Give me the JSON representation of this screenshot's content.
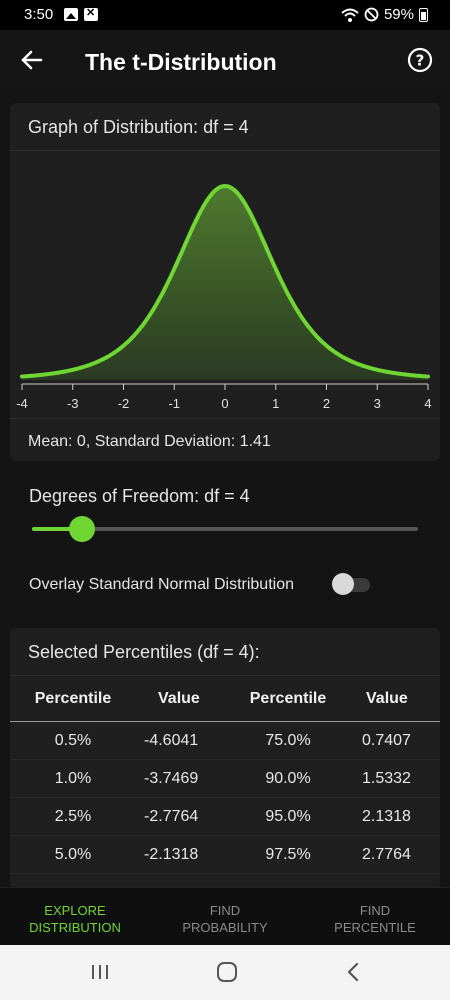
{
  "status_bar": {
    "time": "3:50",
    "battery": "59%",
    "icons": [
      "image-icon",
      "close-box-icon",
      "wifi-icon",
      "do-not-disturb-icon",
      "battery-icon"
    ]
  },
  "app_bar": {
    "title": "The t-Distribution",
    "back_icon": "arrow-left-icon",
    "help_icon": "help-circle-icon"
  },
  "graph_card": {
    "title": "Graph of Distribution: df = 4",
    "stats": "Mean: 0, Standard Deviation: 1.41"
  },
  "chart_data": {
    "type": "area",
    "distribution": "t",
    "df": 4,
    "xlim": [
      -4,
      4
    ],
    "x_ticks": [
      "-4",
      "-3",
      "-2",
      "-1",
      "0",
      "1",
      "2",
      "3",
      "4"
    ],
    "line_color": "#6fd634",
    "fill_color": "#4e7a2e"
  },
  "controls": {
    "df_label": "Degrees of Freedom: df = 4",
    "df_slider_fraction": 0.13,
    "overlay_label": "Overlay Standard Normal Distribution",
    "overlay_on": false
  },
  "percentiles": {
    "title": "Selected Percentiles (df = 4):",
    "headers": [
      "Percentile",
      "Value",
      "Percentile",
      "Value"
    ],
    "rows": [
      [
        "0.5%",
        "-4.6041",
        "75.0%",
        "0.7407"
      ],
      [
        "1.0%",
        "-3.7469",
        "90.0%",
        "1.5332"
      ],
      [
        "2.5%",
        "-2.7764",
        "95.0%",
        "2.1318"
      ],
      [
        "5.0%",
        "-2.1318",
        "97.5%",
        "2.7764"
      ]
    ]
  },
  "bottom_nav": {
    "items": [
      {
        "line1": "EXPLORE",
        "line2": "DISTRIBUTION",
        "active": true
      },
      {
        "line1": "FIND",
        "line2": "PROBABILITY",
        "active": false
      },
      {
        "line1": "FIND",
        "line2": "PERCENTILE",
        "active": false
      }
    ]
  },
  "colors": {
    "accent": "#6fd634",
    "background": "#141414",
    "card": "#1f1f1f"
  }
}
